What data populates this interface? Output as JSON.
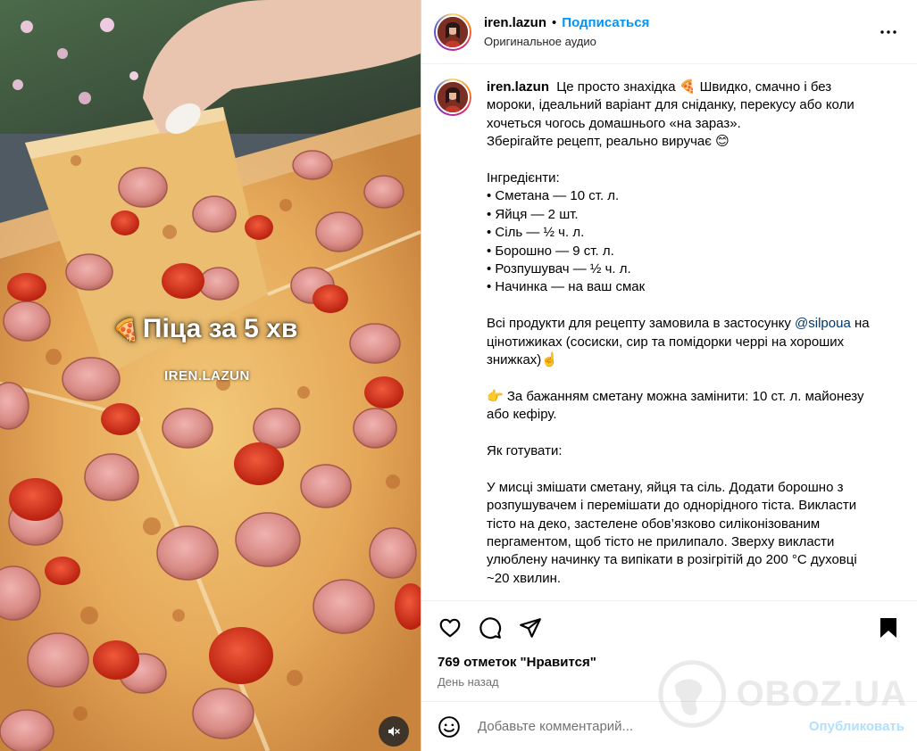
{
  "media": {
    "overlay_emoji": "🍕",
    "overlay_title": "Піца за 5 хв",
    "overlay_brand": "IREN.LAZUN",
    "mute_icon": "speaker-muted-icon"
  },
  "header": {
    "username": "iren.lazun",
    "separator": "•",
    "follow_label": "Подписаться",
    "audio_label": "Оригинальное аудио",
    "more_icon": "more-horizontal-icon"
  },
  "caption": {
    "username": "iren.lazun",
    "lines": {
      "l1": "Це просто знахідка 🍕 Швидко, смачно і без",
      "l2": "мороки, ідеальний варіант для сніданку, перекусу або коли",
      "l3": "хочеться чогось домашнього «на зараз».",
      "l4": "Зберігайте рецепт, реально виручає 😊",
      "l5": "Інгредієнти:",
      "l6": "• Сметана — 10 ст. л.",
      "l7": "• Яйця — 2 шт.",
      "l8": "• Сіль — ½ ч. л.",
      "l9": "• Борошно — 9 ст. л.",
      "l10": "• Розпушувач — ½ ч. л.",
      "l11": "• Начинка — на ваш смак",
      "l12a": "Всі продукти для рецепту замовила в застосунку ",
      "l12m": "@silpoua",
      "l12b": " на",
      "l13": "цінотижиках (сосиски, сир та помідорки черрі на хороших",
      "l14": "знижках)☝️",
      "l15": "👉 За бажанням сметану можна замінити: 10 ст. л. майонезу",
      "l16": "або кефіру.",
      "l17": "Як готувати:",
      "l18": "У мисці змішати сметану, яйця та сіль. Додати борошно з",
      "l19": "розпушувачем і перемішати до однорідного тіста. Викласти",
      "l20": "тісто на деко, застелене обов’язково силіконізованим",
      "l21": "пергаментом, щоб тісто не прилипало. Зверху викласти",
      "l22": "улюблену начинку та випікати в розігрітій до 200 °C духовці",
      "l23": "~20 хвилин."
    }
  },
  "actions": {
    "like_icon": "heart-icon",
    "comment_icon": "comment-icon",
    "share_icon": "paper-plane-icon",
    "save_icon": "bookmark-icon"
  },
  "likes_label": "769 отметок \"Нравится\"",
  "date_label": "День назад",
  "watermark": {
    "text": "OBOZ.UA"
  },
  "comment": {
    "emoji_icon": "smiley-icon",
    "placeholder": "Добавьте комментарий...",
    "publish_label": "Опубликовать"
  },
  "colors": {
    "accent": "#0095f6",
    "publish_disabled": "#b2dffc",
    "mention": "#00376b",
    "muted_text": "#737373"
  }
}
